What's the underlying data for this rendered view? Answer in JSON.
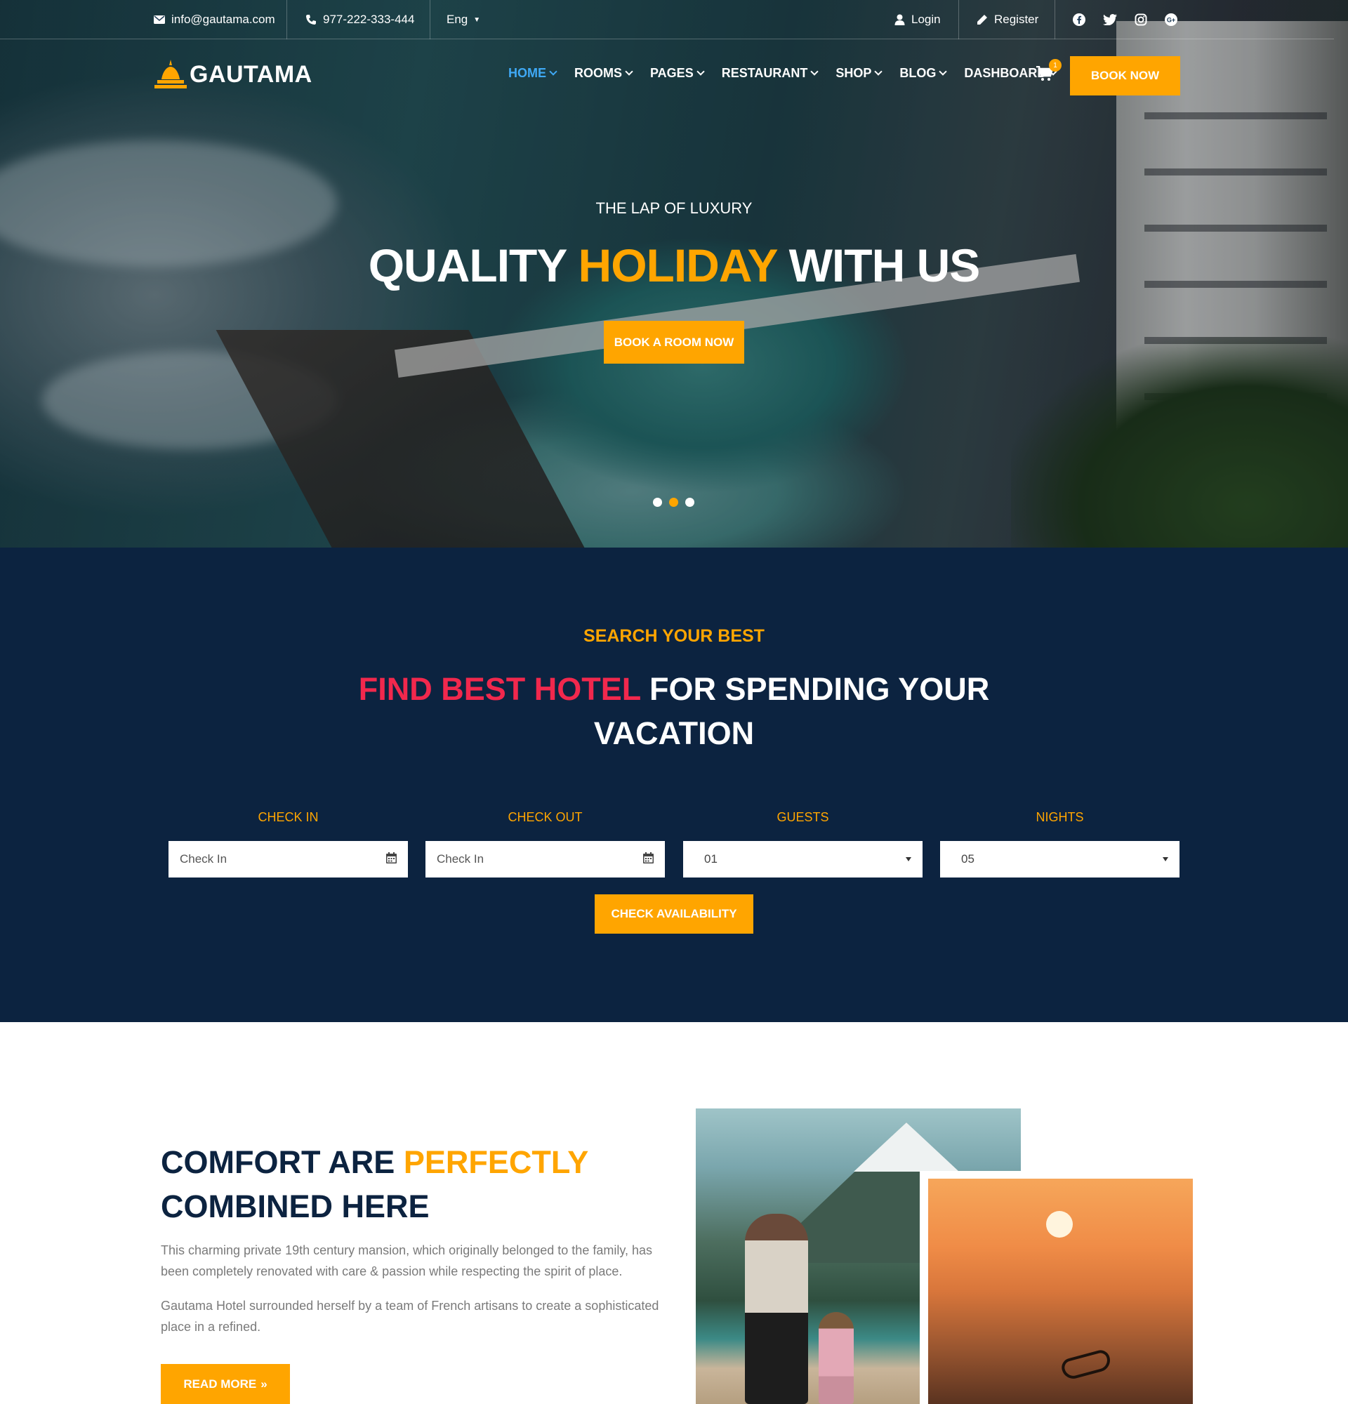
{
  "topbar": {
    "email": "info@gautama.com",
    "phone": "977-222-333-444",
    "language": "Eng",
    "login": "Login",
    "register": "Register",
    "social": [
      "facebook-icon",
      "twitter-icon",
      "instagram-icon",
      "google-plus-icon"
    ]
  },
  "brand": {
    "name": "GAUTAMA"
  },
  "nav": {
    "items": [
      "HOME",
      "ROOMS",
      "PAGES",
      "RESTAURANT",
      "SHOP",
      "BLOG",
      "DASHBOARD"
    ],
    "active": "HOME",
    "cart_count": "1",
    "book_now": "BOOK NOW"
  },
  "hero": {
    "subtitle": "THE LAP OF LUXURY",
    "title_part1": "QUALITY",
    "title_highlight": "HOLIDAY",
    "title_part2": "WITH US",
    "cta": "BOOK A ROOM NOW",
    "slides": 3,
    "active_slide": 2
  },
  "search": {
    "eyebrow": "SEARCH YOUR BEST",
    "title_highlight": "FIND BEST HOTEL",
    "title_rest_line1": "FOR SPENDING YOUR",
    "title_line2": "VACATION",
    "fields": [
      {
        "label": "CHECK IN",
        "value": "Check In",
        "icon": "calendar-icon"
      },
      {
        "label": "CHECK OUT",
        "value": "Check In",
        "icon": "calendar-icon"
      },
      {
        "label": "GUESTS",
        "value": "01"
      },
      {
        "label": "NIGHTS",
        "value": "05"
      }
    ],
    "button": "CHECK AVAILABILITY"
  },
  "about": {
    "title_part1": "COMFORT ARE",
    "title_highlight": "PERFECTLY",
    "title_line2": "COMBINED HERE",
    "paragraph1": "This charming private 19th century mansion, which originally belonged to the family, has been completely renovated with care & passion while respecting the spirit of place.",
    "paragraph2": "Gautama Hotel surrounded herself by a team of French artisans to create a sophisticated place in a refined.",
    "button": "READ MORE"
  },
  "colors": {
    "accent": "#ffa500",
    "navy": "#0c2340",
    "red": "#f1284d",
    "link_active": "#3fa9f5"
  }
}
